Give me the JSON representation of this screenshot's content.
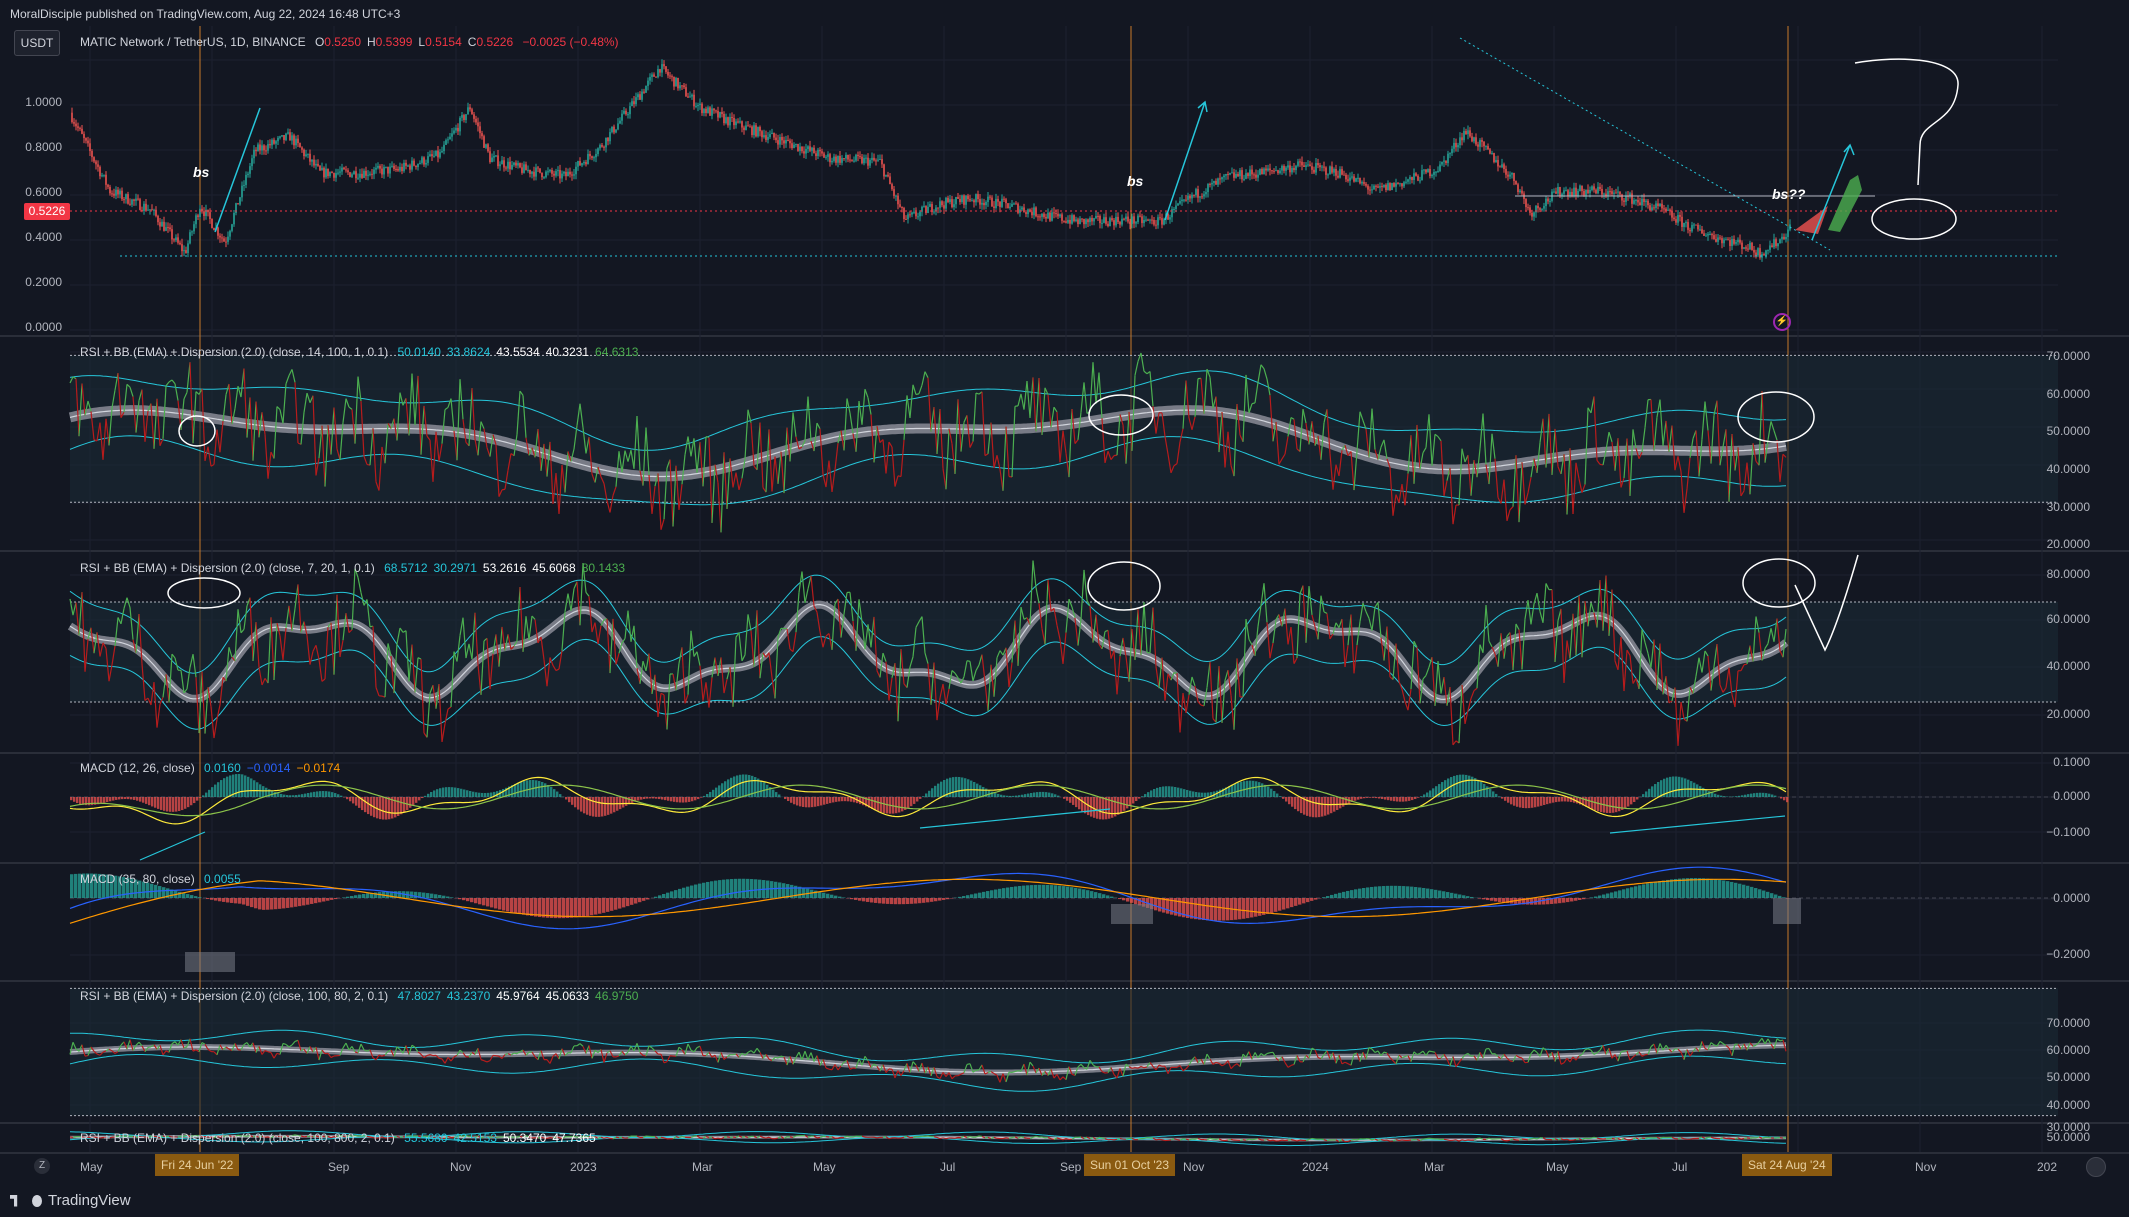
{
  "header": {
    "publisher": "MoralDisciple published on TradingView.com, Aug 22, 2024 16:48 UTC+3"
  },
  "currency_button": "USDT",
  "main": {
    "symbol": "MATIC Network / TetherUS, 1D, BINANCE",
    "ohlc": [
      {
        "k": "O",
        "v": "0.5250"
      },
      {
        "k": "H",
        "v": "0.5399"
      },
      {
        "k": "L",
        "v": "0.5154"
      },
      {
        "k": "C",
        "v": "0.5226"
      }
    ],
    "change": "−0.0025 (−0.48%)",
    "price_tag": "0.5226",
    "yticks": [
      "1.0000",
      "0.8000",
      "0.6000",
      "0.4000",
      "0.2000",
      "0.0000"
    ],
    "notes": [
      "bs",
      "bs",
      "bs??"
    ]
  },
  "rsi1": {
    "name": "RSI + BB (EMA) + Dispersion (2.0) (close, 14, 100, 1, 0.1)",
    "values": [
      "50.0140",
      "33.8624",
      "43.5534",
      "40.3231",
      "64.6313"
    ],
    "yticks": [
      "70.0000",
      "60.0000",
      "50.0000",
      "40.0000",
      "30.0000",
      "20.0000"
    ]
  },
  "rsi2": {
    "name": "RSI + BB (EMA) + Dispersion (2.0) (close, 7, 20, 1, 0.1)",
    "values": [
      "68.5712",
      "30.2971",
      "53.2616",
      "45.6068",
      "80.1433"
    ],
    "yticks": [
      "80.0000",
      "60.0000",
      "40.0000",
      "20.0000"
    ]
  },
  "macd1": {
    "name": "MACD (12, 26, close)",
    "values": [
      "0.0160",
      "−0.0014",
      "−0.0174"
    ],
    "yticks": [
      "0.1000",
      "0.0000",
      "−0.1000"
    ]
  },
  "macd2": {
    "name": "MACD (35, 80, close)",
    "values": [
      "0.0055"
    ],
    "yticks": [
      "0.0000",
      "−0.2000"
    ]
  },
  "rsi3": {
    "name": "RSI + BB (EMA) + Dispersion (2.0) (close, 100, 80, 2, 0.1)",
    "values": [
      "47.8027",
      "43.2370",
      "45.9764",
      "45.0633",
      "46.9750"
    ],
    "yticks": [
      "70.0000",
      "60.0000",
      "50.0000",
      "40.0000",
      "30.0000"
    ]
  },
  "rsi4": {
    "name": "RSI + BB (EMA) + Dispersion (2.0) (close, 100, 800, 2, 0.1)",
    "values": [
      "55.5680",
      "42.5153",
      "50.3470",
      "47.7365"
    ],
    "yticks": [
      "50.0000"
    ]
  },
  "time_axis": {
    "labels": [
      "May",
      "Sep",
      "Nov",
      "2023",
      "Mar",
      "May",
      "Jul",
      "Sep",
      "Nov",
      "2024",
      "Mar",
      "May",
      "Jul",
      "Nov",
      "202"
    ],
    "highlights": [
      "Fri 24 Jun '22",
      "Sun 01 Oct '23",
      "Sat 24 Aug '24"
    ]
  },
  "footer": {
    "brand": "TradingView"
  },
  "colors": {
    "background": "#131722",
    "up": "#26a69a",
    "down": "#ef5350",
    "rsi_green": "#4caf50",
    "rsi_red": "#b71c1c",
    "band": "#26c6da",
    "vline": "#c77a2a",
    "price_tag": "#f23645"
  },
  "icons": [
    "z-icon",
    "settings-icon",
    "lightning-icon",
    "tradingview-logo-icon"
  ]
}
